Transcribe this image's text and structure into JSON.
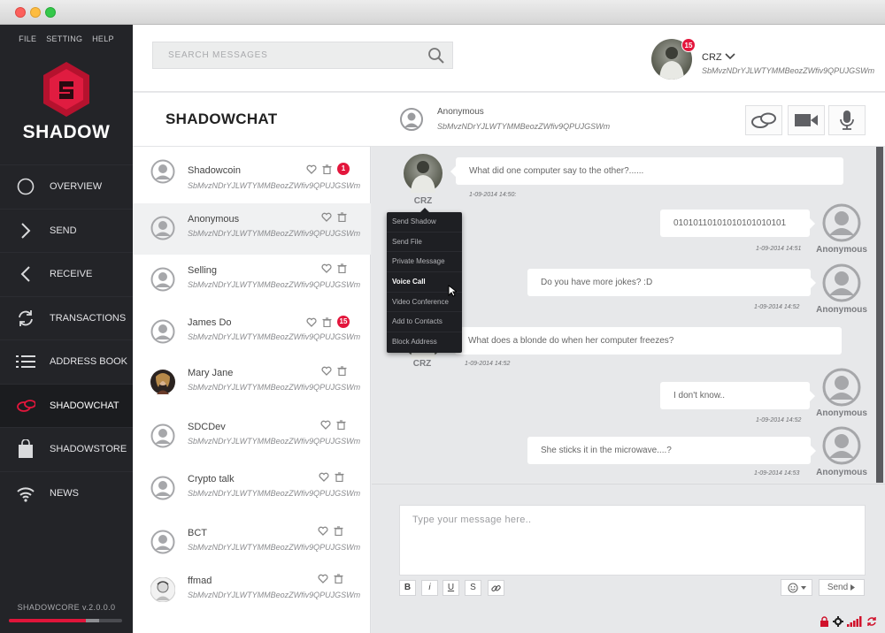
{
  "window": {
    "menu": [
      "FILE",
      "SETTING",
      "HELP"
    ]
  },
  "sidebar": {
    "brand": "SHADOW",
    "items": [
      {
        "label": "OVERVIEW",
        "icon": "circle-icon"
      },
      {
        "label": "SEND",
        "icon": "chevron-right-icon"
      },
      {
        "label": "RECEIVE",
        "icon": "chevron-left-icon"
      },
      {
        "label": "TRANSACTIONS",
        "icon": "refresh-icon"
      },
      {
        "label": "ADDRESS BOOK",
        "icon": "list-icon"
      },
      {
        "label": "SHADOWCHAT",
        "icon": "chat-icon",
        "active": true
      },
      {
        "label": "SHADOWSTORE",
        "icon": "bag-icon"
      },
      {
        "label": "NEWS",
        "icon": "wifi-icon"
      }
    ],
    "version": "SHADOWCORE v.2.0.0.0",
    "sync_progress": 0.68
  },
  "header": {
    "search_placeholder": "SEARCH MESSAGES",
    "user": {
      "name": "CRZ",
      "address": "SbMvzNDrYJLWTYMMBeozZWfiv9QPUJGSWm",
      "badge": "15"
    }
  },
  "chat_header": {
    "title": "SHADOWCHAT",
    "contact_name": "Anonymous",
    "contact_address": "SbMvzNDrYJLWTYMMBeozZWfiv9QPUJGSWm"
  },
  "contacts": [
    {
      "name": "Shadowcoin",
      "address": "SbMvzNDrYJLWTYMMBeozZWfiv9QPUJGSWm",
      "badge": "1"
    },
    {
      "name": "Anonymous",
      "address": "SbMvzNDrYJLWTYMMBeozZWfiv9QPUJGSWm",
      "badge": ""
    },
    {
      "name": "Selling",
      "address": "SbMvzNDrYJLWTYMMBeozZWfiv9QPUJGSWm",
      "badge": ""
    },
    {
      "name": "James Do",
      "address": "SbMvzNDrYJLWTYMMBeozZWfiv9QPUJGSWm",
      "badge": "15"
    },
    {
      "name": "Mary Jane",
      "address": "SbMvzNDrYJLWTYMMBeozZWfiv9QPUJGSWm",
      "badge": ""
    },
    {
      "name": "SDCDev",
      "address": "SbMvzNDrYJLWTYMMBeozZWfiv9QPUJGSWm",
      "badge": ""
    },
    {
      "name": "Crypto talk",
      "address": "SbMvzNDrYJLWTYMMBeozZWfiv9QPUJGSWm",
      "badge": ""
    },
    {
      "name": "BCT",
      "address": "SbMvzNDrYJLWTYMMBeozZWfiv9QPUJGSWm",
      "badge": ""
    },
    {
      "name": "ffmad",
      "address": "SbMvzNDrYJLWTYMMBeozZWfiv9QPUJGSWm",
      "badge": ""
    }
  ],
  "messages": [
    {
      "from": "CRZ",
      "text": "What did one computer say to the other?......",
      "time": "1-09-2014 14:50:"
    },
    {
      "from": "Anonymous",
      "text": "01010110101010101010101",
      "time": "1-09-2014 14:51"
    },
    {
      "from": "Anonymous",
      "text": "Do you have more jokes? :D",
      "time": "1-09-2014 14:52"
    },
    {
      "from": "CRZ",
      "text": "What does a blonde do when her computer freezes?",
      "time": "1-09-2014 14:52"
    },
    {
      "from": "Anonymous",
      "text": "I don't know..",
      "time": "1-09-2014 14:52"
    },
    {
      "from": "Anonymous",
      "text": "She sticks it in the microwave....?",
      "time": "1-09-2014 14:53"
    }
  ],
  "context_menu": [
    "Send Shadow",
    "Send File",
    "Private Message",
    "Voice Call",
    "Video Conference",
    "Add to Contacts",
    "Block Address"
  ],
  "composer": {
    "placeholder": "Type your message here..",
    "format_buttons": [
      "B",
      "i",
      "U",
      "S"
    ],
    "send_label": "Send"
  },
  "colors": {
    "accent": "#e3163c",
    "sidebar_bg": "#232428"
  }
}
